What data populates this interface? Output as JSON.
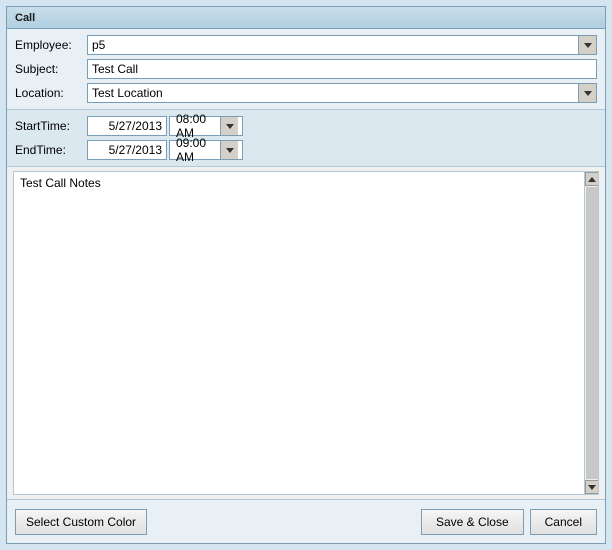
{
  "window": {
    "title": "Call"
  },
  "form": {
    "employee_label": "Employee:",
    "employee_value": "p5",
    "subject_label": "Subject:",
    "subject_value": "Test Call",
    "location_label": "Location:",
    "location_value": "Test Location"
  },
  "datetime": {
    "start_label": "StartTime:",
    "start_date": "5/27/2013",
    "start_time": "08:00 AM",
    "end_label": "EndTime:",
    "end_date": "5/27/2013",
    "end_time": "09:00 AM"
  },
  "notes": {
    "content": "Test Call Notes"
  },
  "footer": {
    "select_color_label": "Select Custom Color",
    "save_close_label": "Save & Close",
    "cancel_label": "Cancel"
  }
}
